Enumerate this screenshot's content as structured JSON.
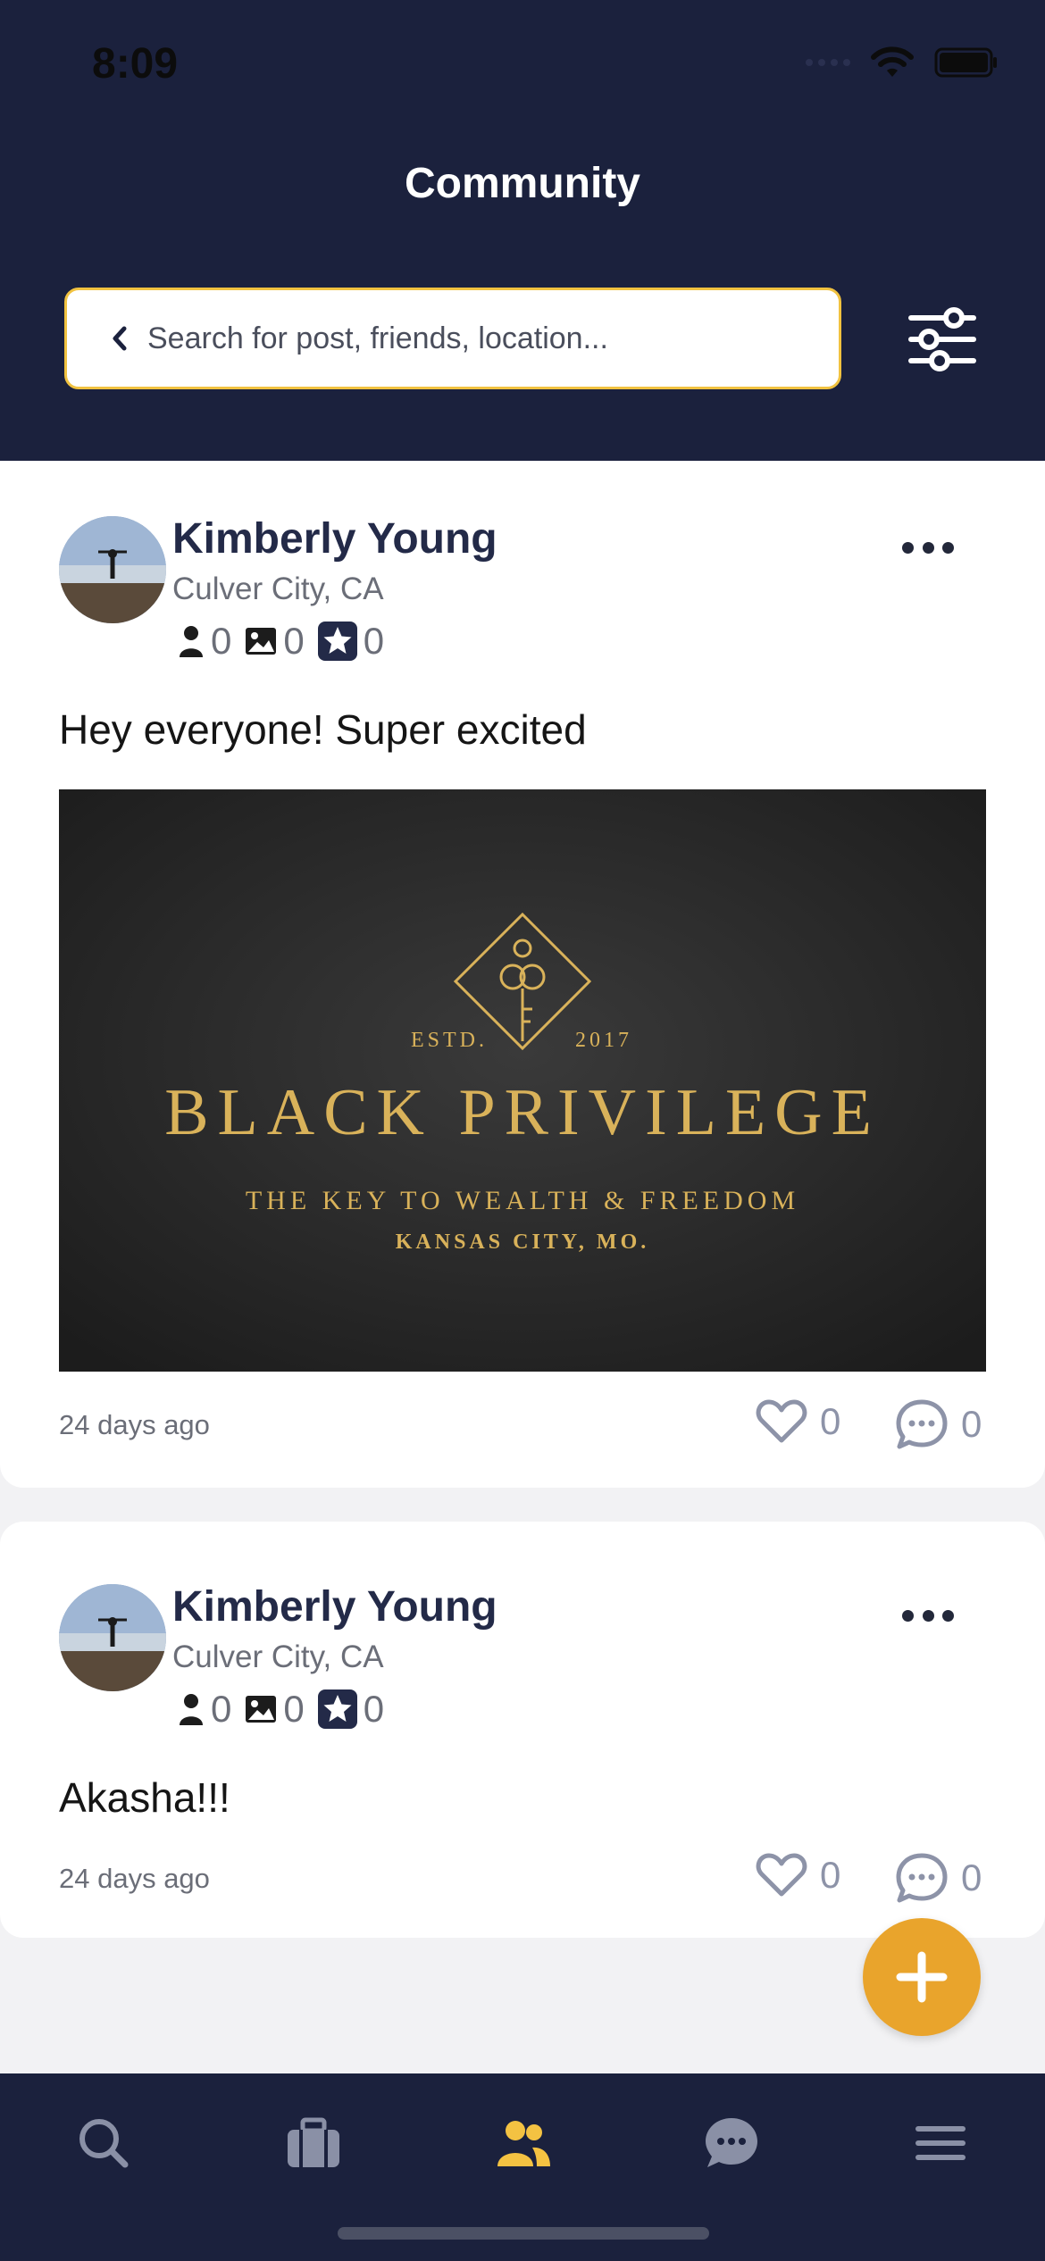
{
  "status_bar": {
    "time": "8:09"
  },
  "header": {
    "title": "Community",
    "search_placeholder": "Search for post, friends, location..."
  },
  "posts": [
    {
      "author": "Kimberly Young",
      "location": "Culver City, CA",
      "stats": {
        "friends": "0",
        "photos": "0",
        "stars": "0"
      },
      "text": "Hey everyone! Super excited",
      "image": {
        "estd": "ESTD.",
        "year": "2017",
        "brand": "BLACK PRIVILEGE",
        "tagline": "THE KEY TO WEALTH & FREEDOM",
        "place": "KANSAS CITY, MO."
      },
      "time": "24 days ago",
      "likes": "0",
      "comments": "0"
    },
    {
      "author": "Kimberly Young",
      "location": "Culver City, CA",
      "stats": {
        "friends": "0",
        "photos": "0",
        "stars": "0"
      },
      "text": "Akasha!!!",
      "time": "24 days ago",
      "likes": "0",
      "comments": "0"
    }
  ],
  "tabs": [
    {
      "icon": "search-icon",
      "active": false
    },
    {
      "icon": "briefcase-icon",
      "active": false
    },
    {
      "icon": "community-icon",
      "active": true
    },
    {
      "icon": "chat-icon",
      "active": false
    },
    {
      "icon": "menu-icon",
      "active": false
    }
  ],
  "colors": {
    "navy": "#1b213d",
    "accent_gold": "#e9a42c",
    "search_border": "#f1c240",
    "active_tab": "#f4c242",
    "inactive_tab": "#8a90a6"
  }
}
